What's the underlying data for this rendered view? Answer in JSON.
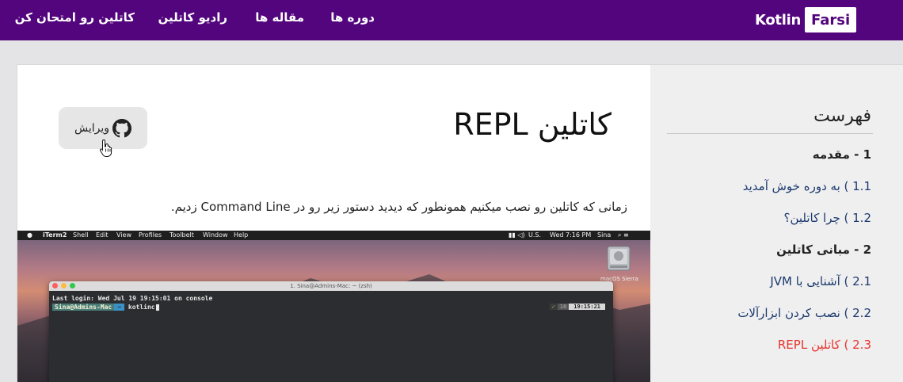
{
  "header": {
    "logo": {
      "kotlin": "Kotlin",
      "farsi": "Farsi"
    },
    "nav": [
      {
        "id": "courses",
        "label": "دوره ها"
      },
      {
        "id": "articles",
        "label": "مقاله ها"
      },
      {
        "id": "radio",
        "label": "رادیو کاتلین"
      },
      {
        "id": "quiz",
        "label": "کاتلین رو امتحان کن"
      }
    ],
    "colors": {
      "nav_bg": "#52057d",
      "accent_red": "#e8332c"
    }
  },
  "article": {
    "title": "کاتلین REPL",
    "edit_label": "ویرایش",
    "edit_icon": "github-icon",
    "intro": "زمانی که کاتلین رو نصب میکنیم همونطور که دیدید دستور زیر رو در Command Line زدیم.",
    "screenshot": {
      "menubar": {
        "app": "iTerm2",
        "items": [
          "Shell",
          "Edit",
          "View",
          "Profiles",
          "Toolbelt",
          "Window",
          "Help"
        ],
        "status": {
          "locale": "U.S.",
          "clock": "Wed 7:16 PM",
          "user": "Sina"
        }
      },
      "desktop_disk_label": "macOS Sierra",
      "terminal": {
        "title": "1. Sina@Admins-Mac: ~ (zsh)",
        "last_login": "Last login: Wed Jul 19 19:15:01 on console",
        "prompt_user": "Sina@Admins-Mac",
        "prompt_path": "~",
        "command": "kotlinc",
        "right_check": "✓",
        "right_arrow": "10",
        "right_time": "19:15:21"
      }
    }
  },
  "toc": {
    "title": "فهرست",
    "items": [
      {
        "label": "1 - مقدمه",
        "kind": "section"
      },
      {
        "label": "1.1 ) به دوره خوش آمدید",
        "kind": "link"
      },
      {
        "label": "1.2 ) چرا کاتلین؟",
        "kind": "link"
      },
      {
        "label": "2 - مبانی کاتلین",
        "kind": "section"
      },
      {
        "label": "2.1 ) آشنایی با JVM",
        "kind": "link"
      },
      {
        "label": "2.2 ) نصب کردن ابزارآلات",
        "kind": "link"
      },
      {
        "label": "2.3 ) کاتلین REPL",
        "kind": "active"
      }
    ]
  }
}
